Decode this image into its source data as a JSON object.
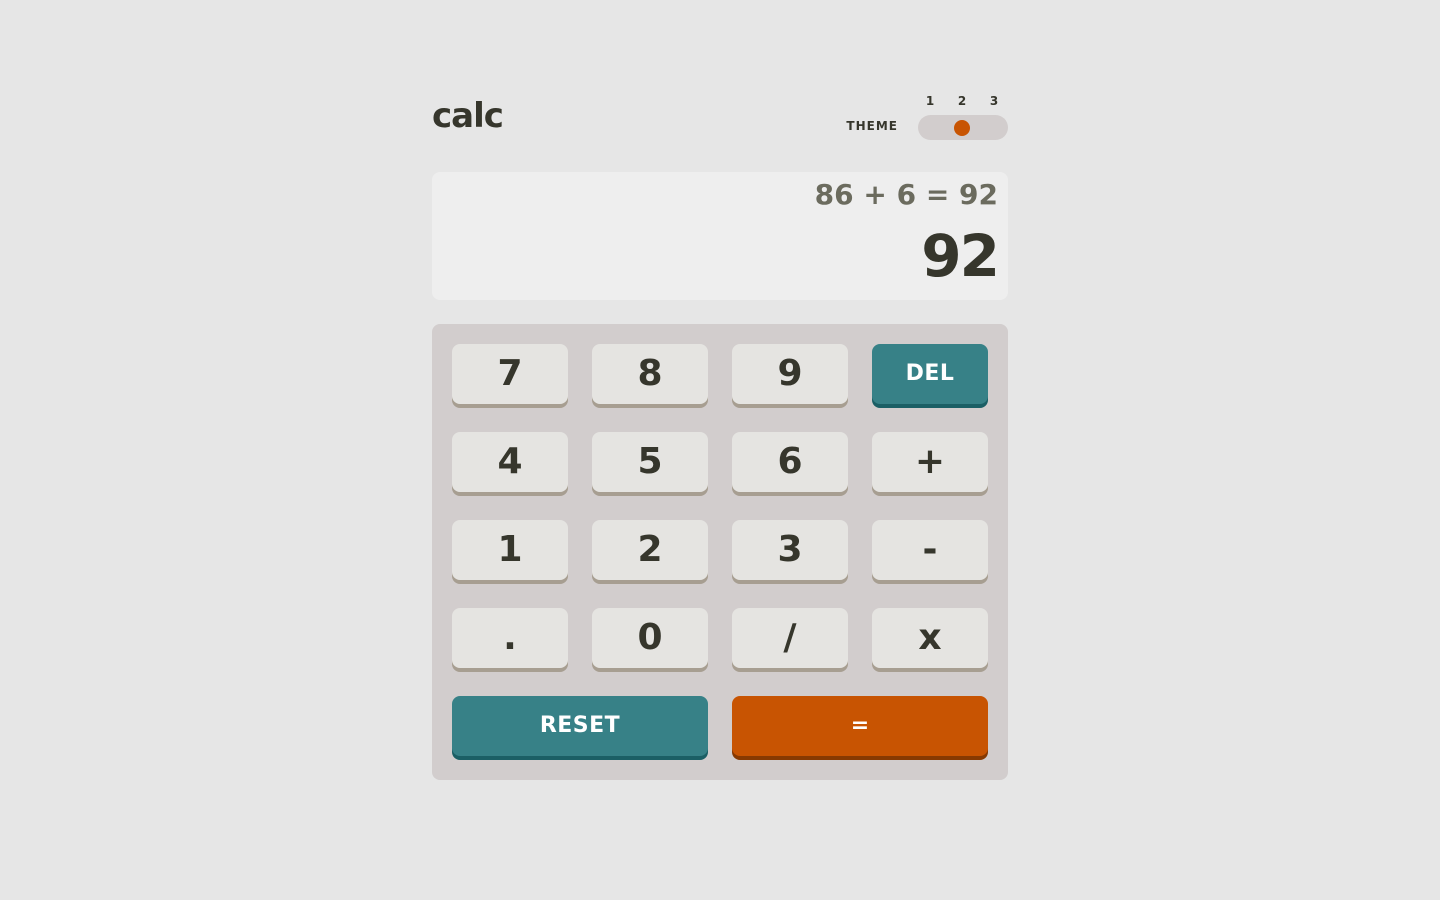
{
  "app": {
    "logo": "calc"
  },
  "theme": {
    "label": "THEME",
    "options": [
      "1",
      "2",
      "3"
    ],
    "selected": "2",
    "knob_color": "#c85402"
  },
  "display": {
    "equation": "86 + 6 = 92",
    "result": "92"
  },
  "keypad": {
    "rows": [
      [
        "7",
        "8",
        "9",
        "DEL"
      ],
      [
        "4",
        "5",
        "6",
        "+"
      ],
      [
        "1",
        "2",
        "3",
        "-"
      ],
      [
        ".",
        "0",
        "/",
        "x"
      ]
    ],
    "reset_label": "RESET",
    "equals_label": "="
  },
  "colors": {
    "background": "#e6e6e6",
    "keypad_bg": "#d2cdcd",
    "screen_bg": "#eeeeee",
    "key_bg": "#e5e4e1",
    "key_shadow": "#a79e91",
    "func_key": "#378187",
    "equals_key": "#c85402",
    "text_dark": "#36362c"
  }
}
